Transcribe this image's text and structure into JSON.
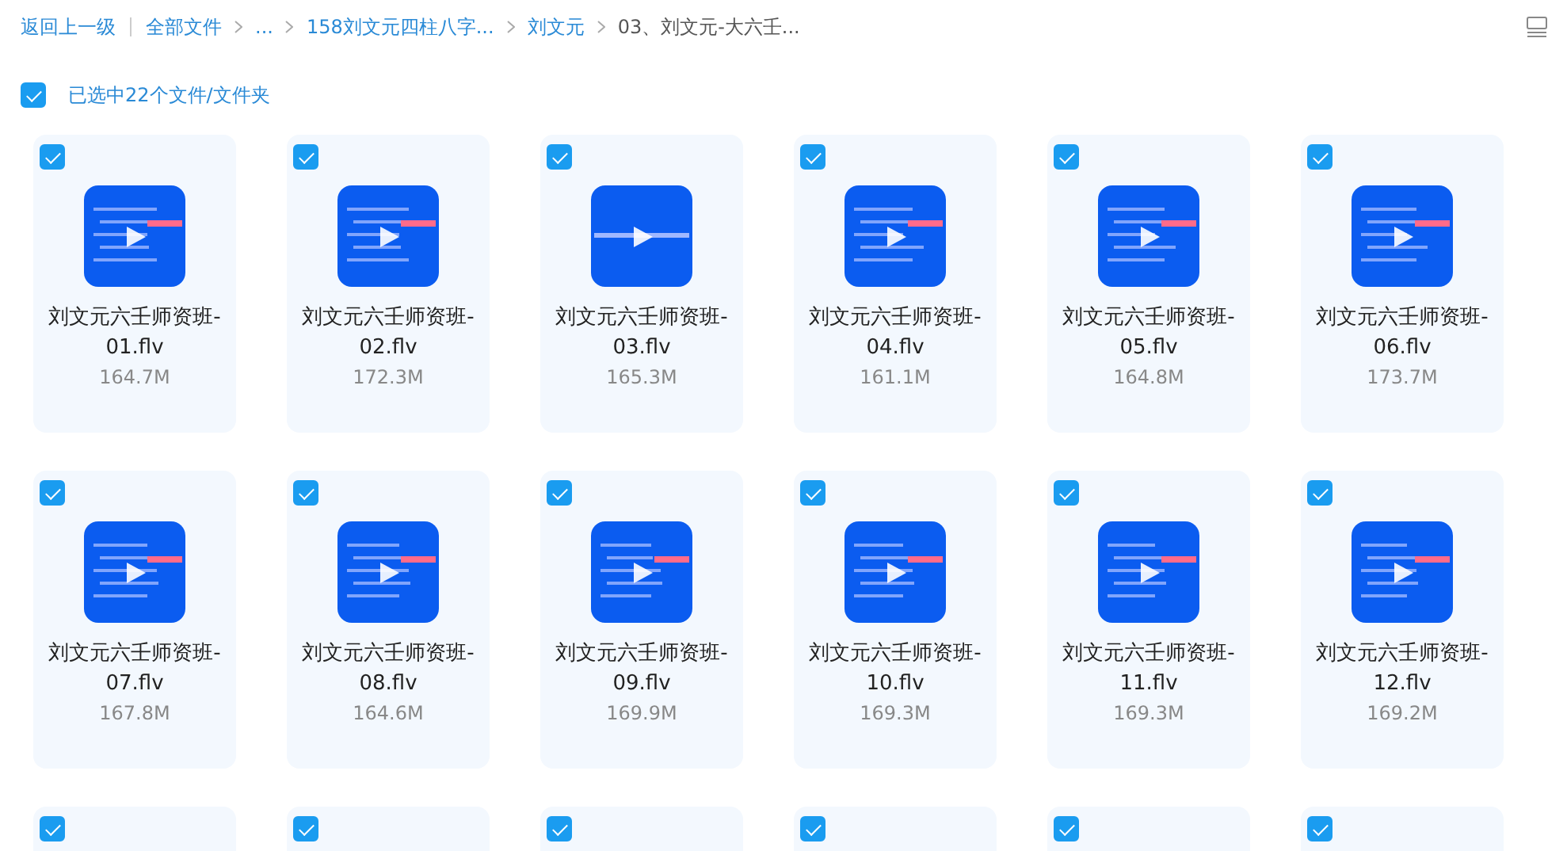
{
  "breadcrumb": {
    "back": "返回上一级",
    "items": [
      {
        "label": "全部文件",
        "current": false
      },
      {
        "label": "...",
        "current": false
      },
      {
        "label": "158刘文元四柱八字...",
        "current": false
      },
      {
        "label": "刘文元",
        "current": false
      },
      {
        "label": "03、刘文元-大六壬...",
        "current": true
      }
    ]
  },
  "selection": {
    "checked": true,
    "label": "已选中22个文件/文件夹"
  },
  "files": [
    {
      "checked": true,
      "name": "刘文元六壬师资班-01.flv",
      "size": "164.7M"
    },
    {
      "checked": true,
      "name": "刘文元六壬师资班-02.flv",
      "size": "172.3M"
    },
    {
      "checked": true,
      "name": "刘文元六壬师资班-03.flv",
      "size": "165.3M"
    },
    {
      "checked": true,
      "name": "刘文元六壬师资班-04.flv",
      "size": "161.1M"
    },
    {
      "checked": true,
      "name": "刘文元六壬师资班-05.flv",
      "size": "164.8M"
    },
    {
      "checked": true,
      "name": "刘文元六壬师资班-06.flv",
      "size": "173.7M"
    },
    {
      "checked": true,
      "name": "刘文元六壬师资班-07.flv",
      "size": "167.8M"
    },
    {
      "checked": true,
      "name": "刘文元六壬师资班-08.flv",
      "size": "164.6M"
    },
    {
      "checked": true,
      "name": "刘文元六壬师资班-09.flv",
      "size": "169.9M"
    },
    {
      "checked": true,
      "name": "刘文元六壬师资班-10.flv",
      "size": "169.3M"
    },
    {
      "checked": true,
      "name": "刘文元六壬师资班-11.flv",
      "size": "169.3M"
    },
    {
      "checked": true,
      "name": "刘文元六壬师资班-12.flv",
      "size": "169.2M"
    },
    {
      "checked": true
    },
    {
      "checked": true
    },
    {
      "checked": true
    },
    {
      "checked": true
    },
    {
      "checked": true
    },
    {
      "checked": true
    }
  ]
}
